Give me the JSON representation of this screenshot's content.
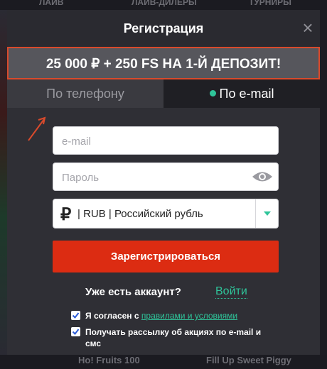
{
  "background": {
    "top_items": [
      "ЛАЙВ",
      "ЛАЙВ-ДИЛЕРЫ",
      "ТУРНИРЫ"
    ],
    "bottom_items": [
      "Ho! Fruits 100",
      "Fill Up Sweet Piggy"
    ]
  },
  "modal": {
    "title": "Регистрация",
    "close_symbol": "×",
    "promo": "25 000 ₽ + 250 FS НА 1-Й ДЕПОЗИТ!",
    "tabs": {
      "phone_label": "По телефону",
      "email_label": "По e-mail",
      "active": "email"
    },
    "form": {
      "email_placeholder": "e-mail",
      "password_placeholder": "Пароль",
      "currency_symbol": "₽",
      "currency_value": "| RUB | Российский рубль",
      "register_label": "Зарегистрироваться",
      "have_account": "Уже есть аккаунт?",
      "login_label": "Войти"
    },
    "agreements": [
      {
        "checked": true,
        "text": "Я согласен с ",
        "link": "правилами и условиями"
      },
      {
        "checked": true,
        "text": "Получать рассылку об акциях по e-mail и смс",
        "link": ""
      }
    ]
  },
  "colors": {
    "accent_green": "#2fc59a",
    "register_red": "#dc2c12",
    "promo_border": "#d94a2c"
  }
}
